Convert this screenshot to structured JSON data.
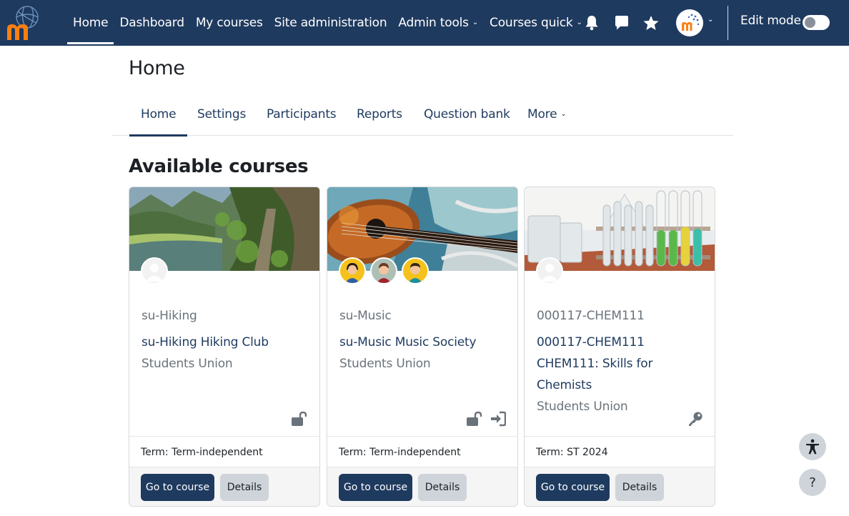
{
  "navbar": {
    "logo_icon": "moodle-logo-icon",
    "items": [
      {
        "label": "Home",
        "active": true
      },
      {
        "label": "Dashboard"
      },
      {
        "label": "My courses"
      },
      {
        "label": "Site administration"
      },
      {
        "label": "Admin tools",
        "dropdown": true
      },
      {
        "label": "Courses quick",
        "dropdown": true
      }
    ],
    "notification_icon": "bell-icon",
    "messages_icon": "chat-bubble-icon",
    "starred_icon": "star-icon",
    "user_avatar_icon": "user-avatar-icon",
    "edit_mode_label": "Edit mode",
    "edit_mode_on": false
  },
  "page": {
    "title": "Home",
    "tabs": [
      {
        "label": "Home",
        "active": true
      },
      {
        "label": "Settings"
      },
      {
        "label": "Participants"
      },
      {
        "label": "Reports"
      },
      {
        "label": "Question bank"
      },
      {
        "label": "More",
        "dropdown": true
      }
    ],
    "section_title": "Available courses"
  },
  "courses": [
    {
      "image": "mountain-lake-trail-image",
      "shortname": "su-Hiking",
      "fullname": "su-Hiking Hiking Club",
      "category": "Students Union",
      "enrol_icons": [
        "unlock-icon"
      ],
      "term": "Term: Term-independent",
      "go_label": "Go to course",
      "details_label": "Details"
    },
    {
      "image": "guitar-image",
      "shortname": "su-Music",
      "fullname": "su-Music Music Society",
      "category": "Students Union",
      "enrol_icons": [
        "unlock-icon",
        "sign-in-icon"
      ],
      "term": "Term: Term-independent",
      "go_label": "Go to course",
      "details_label": "Details"
    },
    {
      "image": "test-tubes-image",
      "shortname": "000117-CHEM111",
      "fullname": "000117-CHEM111 CHEM111: Skills for Chemists",
      "category": "Students Union",
      "enrol_icons": [
        "key-icon"
      ],
      "term": "Term: ST 2024",
      "go_label": "Go to course",
      "details_label": "Details"
    }
  ],
  "floating": {
    "accessibility_icon": "accessibility-icon",
    "help_label": "?"
  },
  "colors": {
    "navbar": "#1f3a5f",
    "primary": "#1f3a5f",
    "secondary_button": "#ced4da",
    "logo_orange": "#f98012"
  }
}
